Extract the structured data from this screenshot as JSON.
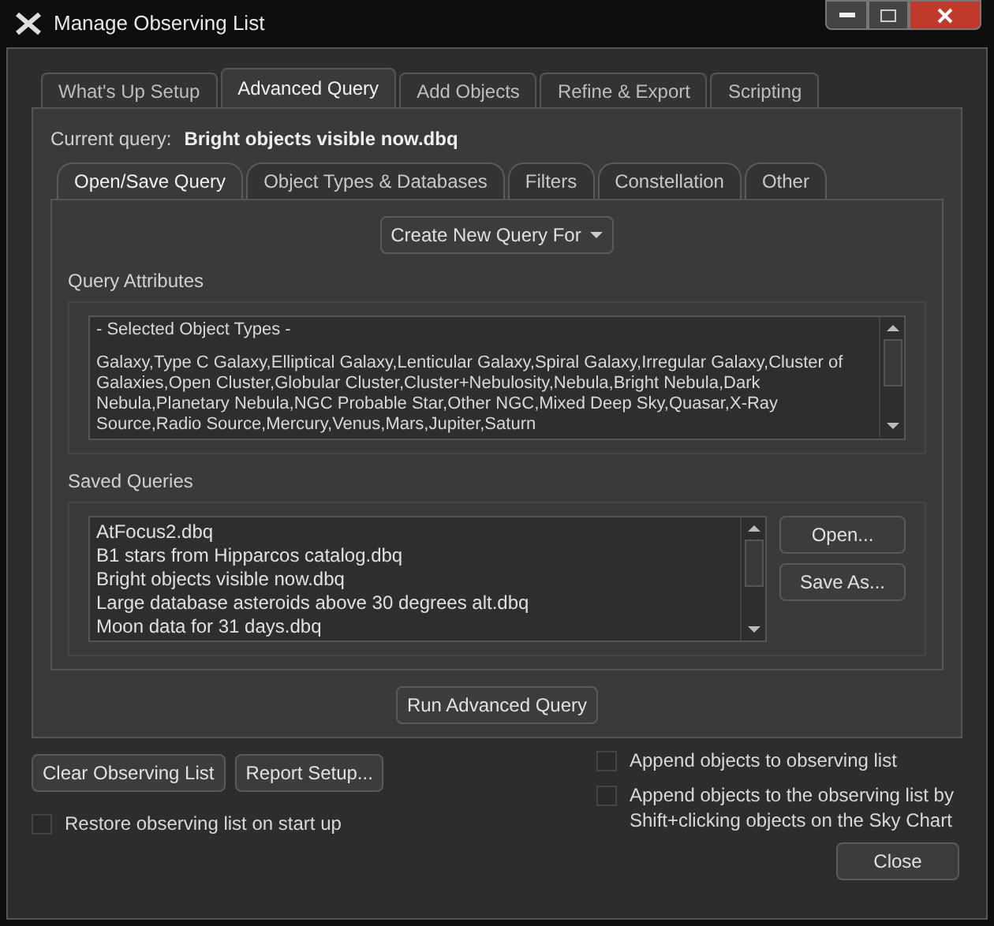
{
  "window": {
    "title": "Manage Observing List"
  },
  "tabs": [
    {
      "label": "What's Up Setup",
      "selected": false
    },
    {
      "label": "Advanced Query",
      "selected": true
    },
    {
      "label": "Add Objects",
      "selected": false
    },
    {
      "label": "Refine & Export",
      "selected": false
    },
    {
      "label": "Scripting",
      "selected": false
    }
  ],
  "current_query": {
    "label": "Current query:",
    "value": "Bright objects visible now.dbq"
  },
  "sub_tabs": [
    {
      "label": "Open/Save Query",
      "selected": true
    },
    {
      "label": "Object Types & Databases",
      "selected": false
    },
    {
      "label": "Filters",
      "selected": false
    },
    {
      "label": "Constellation",
      "selected": false
    },
    {
      "label": "Other",
      "selected": false
    }
  ],
  "create_button": "Create New Query For",
  "query_attributes": {
    "title": "Query Attributes",
    "heading": "- Selected Object Types -",
    "text": "Galaxy,Type C Galaxy,Elliptical Galaxy,Lenticular Galaxy,Spiral Galaxy,Irregular Galaxy,Cluster of Galaxies,Open Cluster,Globular Cluster,Cluster+Nebulosity,Nebula,Bright Nebula,Dark Nebula,Planetary Nebula,NGC Probable Star,Other NGC,Mixed Deep Sky,Quasar,X-Ray Source,Radio Source,Mercury,Venus,Mars,Jupiter,Saturn"
  },
  "saved_queries": {
    "title": "Saved Queries",
    "items": [
      {
        "label": "AtFocus2.dbq"
      },
      {
        "label": "B1 stars from Hipparcos catalog.dbq"
      },
      {
        "label": "Bright objects visible now.dbq"
      },
      {
        "label": "Large database asteroids above 30 degrees alt.dbq"
      },
      {
        "label": "Moon data for 31 days.dbq"
      }
    ],
    "buttons": [
      "Open...",
      "Save As..."
    ]
  },
  "run_button": "Run Advanced Query",
  "bottom_buttons": [
    "Clear Observing List",
    "Report Setup..."
  ],
  "checkboxes": [
    {
      "label": "Append objects to observing list",
      "checked": false
    },
    {
      "label": "Restore observing list on start up",
      "checked": false
    },
    {
      "label": "Append objects to the observing list by Shift+clicking objects on the Sky Chart",
      "checked": false
    }
  ],
  "close_button": "Close"
}
